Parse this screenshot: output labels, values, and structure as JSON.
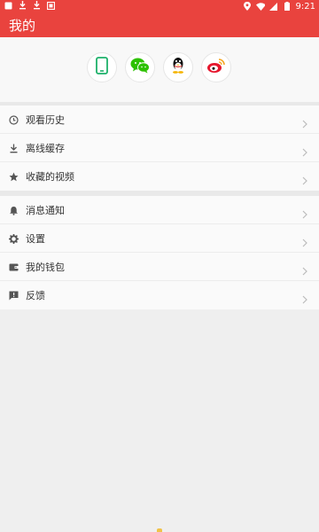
{
  "status_bar": {
    "time": "9:21",
    "icons": [
      "notification-square-icon",
      "download-icon",
      "download-icon",
      "gallery-icon",
      "location-icon",
      "wifi-icon",
      "signal-icon",
      "battery-icon"
    ]
  },
  "app_bar": {
    "title": "我的"
  },
  "login_options": [
    {
      "name": "phone-login-button",
      "icon": "phone-icon",
      "color": "#1db06a"
    },
    {
      "name": "wechat-login-button",
      "icon": "wechat-icon",
      "color": "#2dc100"
    },
    {
      "name": "qq-login-button",
      "icon": "qq-penguin-icon",
      "color": "#000000"
    },
    {
      "name": "weibo-login-button",
      "icon": "weibo-icon",
      "color": "#e6162d"
    }
  ],
  "menu_section_1": [
    {
      "label": "观看历史",
      "icon": "history-clock-icon"
    },
    {
      "label": "离线缓存",
      "icon": "download-icon"
    },
    {
      "label": "收藏的视频",
      "icon": "star-icon"
    }
  ],
  "menu_section_2": [
    {
      "label": "消息通知",
      "icon": "bell-icon"
    },
    {
      "label": "设置",
      "icon": "gear-icon"
    },
    {
      "label": "我的钱包",
      "icon": "wallet-icon"
    },
    {
      "label": "反馈",
      "icon": "feedback-icon"
    }
  ],
  "colors": {
    "accent": "#e9433e",
    "background": "#efefef",
    "row_bg": "#fafafa"
  }
}
